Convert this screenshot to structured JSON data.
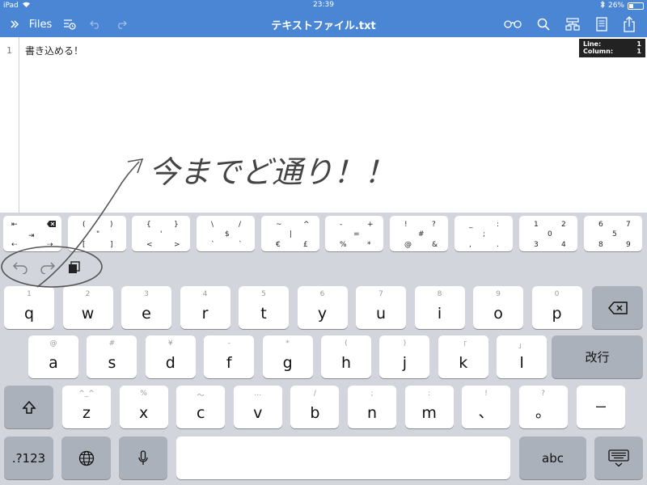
{
  "status_bar": {
    "device": "iPad",
    "time": "23:39",
    "battery": "26%"
  },
  "toolbar": {
    "title": "テキストファイル.txt",
    "files_label": "Files",
    "icons": [
      "chevron-double-right-icon",
      "recent-icon",
      "undo-icon",
      "redo-icon",
      "glasses-icon",
      "search-icon",
      "structure-icon",
      "document-icon",
      "share-icon"
    ]
  },
  "editor": {
    "line_number": "1",
    "text": "書き込める！",
    "cursor_info": {
      "line_label": "Line:",
      "line_value": "1",
      "column_label": "Column:",
      "column_value": "1"
    },
    "annotation": "今までど通り！！"
  },
  "accessory_bar": {
    "keys": [
      [
        "⇤",
        "⇥",
        "⇠",
        "⇢"
      ],
      [
        "(",
        ")",
        "[",
        "\"",
        "]"
      ],
      [
        "{",
        "}",
        "<",
        "'",
        ">"
      ],
      [
        "\\",
        "/",
        "`",
        "$",
        "`"
      ],
      [
        "~",
        "^",
        "€",
        "|",
        "£"
      ],
      [
        "-",
        "+",
        "%",
        "=",
        "*"
      ],
      [
        "!",
        "?",
        "@",
        "#",
        "&"
      ],
      [
        "_",
        ":",
        ",",
        ";",
        "."
      ],
      [
        "1",
        "2",
        "3",
        "0",
        "4"
      ],
      [
        "6",
        "7",
        "8",
        "5",
        "9"
      ]
    ]
  },
  "keyboard": {
    "row1": [
      {
        "main": "q",
        "sub": "1"
      },
      {
        "main": "w",
        "sub": "2"
      },
      {
        "main": "e",
        "sub": "3"
      },
      {
        "main": "r",
        "sub": "4"
      },
      {
        "main": "t",
        "sub": "5"
      },
      {
        "main": "y",
        "sub": "6"
      },
      {
        "main": "u",
        "sub": "7"
      },
      {
        "main": "i",
        "sub": "8"
      },
      {
        "main": "o",
        "sub": "9"
      },
      {
        "main": "p",
        "sub": "0"
      }
    ],
    "row2": [
      {
        "main": "a",
        "sub": "@"
      },
      {
        "main": "s",
        "sub": "#"
      },
      {
        "main": "d",
        "sub": "¥"
      },
      {
        "main": "f",
        "sub": "-"
      },
      {
        "main": "g",
        "sub": "*"
      },
      {
        "main": "h",
        "sub": "("
      },
      {
        "main": "j",
        "sub": ")"
      },
      {
        "main": "k",
        "sub": "「"
      },
      {
        "main": "l",
        "sub": "」"
      }
    ],
    "return_label": "改行",
    "row3": [
      {
        "main": "z",
        "sub": "^_^"
      },
      {
        "main": "x",
        "sub": "%"
      },
      {
        "main": "c",
        "sub": "〜"
      },
      {
        "main": "v",
        "sub": "…"
      },
      {
        "main": "b",
        "sub": "/"
      },
      {
        "main": "n",
        "sub": ";"
      },
      {
        "main": "m",
        "sub": ":"
      }
    ],
    "punct_keys": [
      {
        "main": "、",
        "sub": "!"
      },
      {
        "main": "。",
        "sub": "?"
      }
    ],
    "dash_label": "ー",
    "numbers_label": ".?123",
    "abc_label": "abc"
  }
}
